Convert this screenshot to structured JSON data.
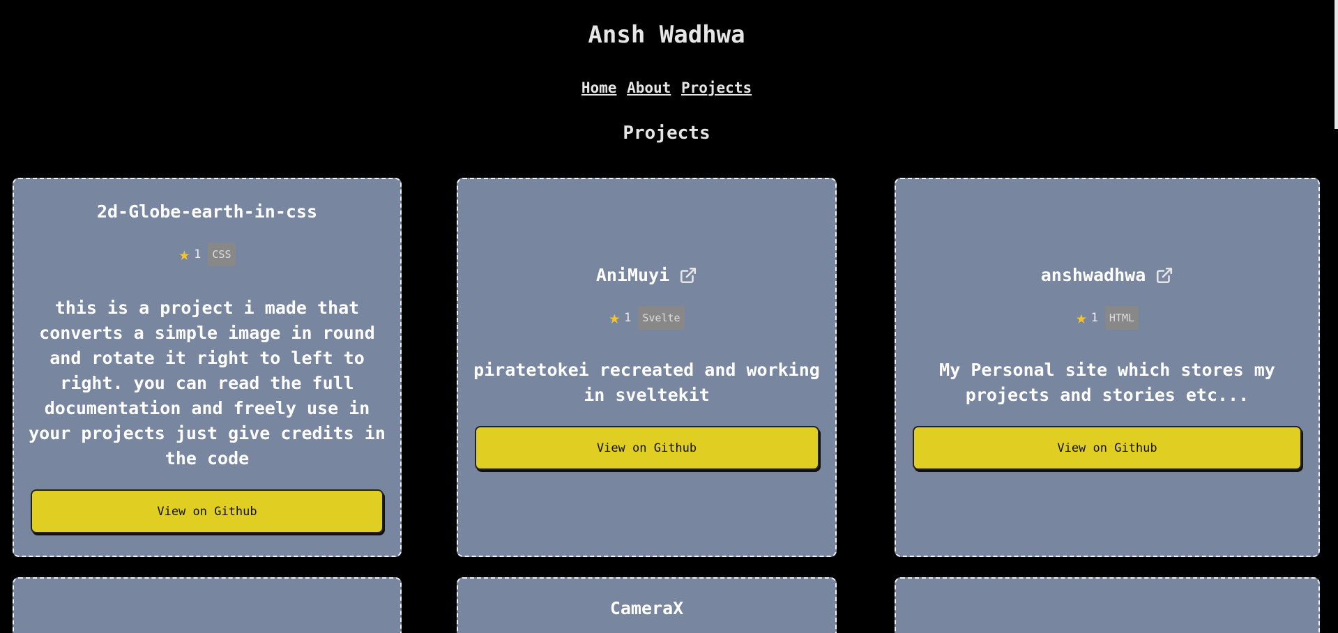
{
  "header": {
    "site_title": "Ansh Wadhwa",
    "nav": [
      "Home",
      "About",
      "Projects"
    ],
    "section_title": "Projects"
  },
  "colors": {
    "background": "#000000",
    "card": "#7886a0",
    "button": "#e0cf22",
    "star": "#f4c430",
    "badge": "#888888"
  },
  "projects": [
    {
      "name": "2d-Globe-earth-in-css",
      "has_link_icon": false,
      "stars": "1",
      "language": "CSS",
      "description": "this is a project i made that converts a simple image in round and rotate it right to left to right. you can read the full documentation and freely use in your projects just give credits in the code",
      "button_label": "View on Github"
    },
    {
      "name": "AniMuyi",
      "has_link_icon": true,
      "stars": "1",
      "language": "Svelte",
      "description": "piratetokei recreated and working in sveltekit",
      "button_label": "View on Github"
    },
    {
      "name": "anshwadhwa",
      "has_link_icon": true,
      "stars": "1",
      "language": "HTML",
      "description": "My Personal site which stores my projects and stories etc...",
      "button_label": "View on Github"
    },
    {
      "name": "",
      "partial": true
    },
    {
      "name": "CameraX",
      "partial": true
    },
    {
      "name": "",
      "partial": true
    }
  ]
}
